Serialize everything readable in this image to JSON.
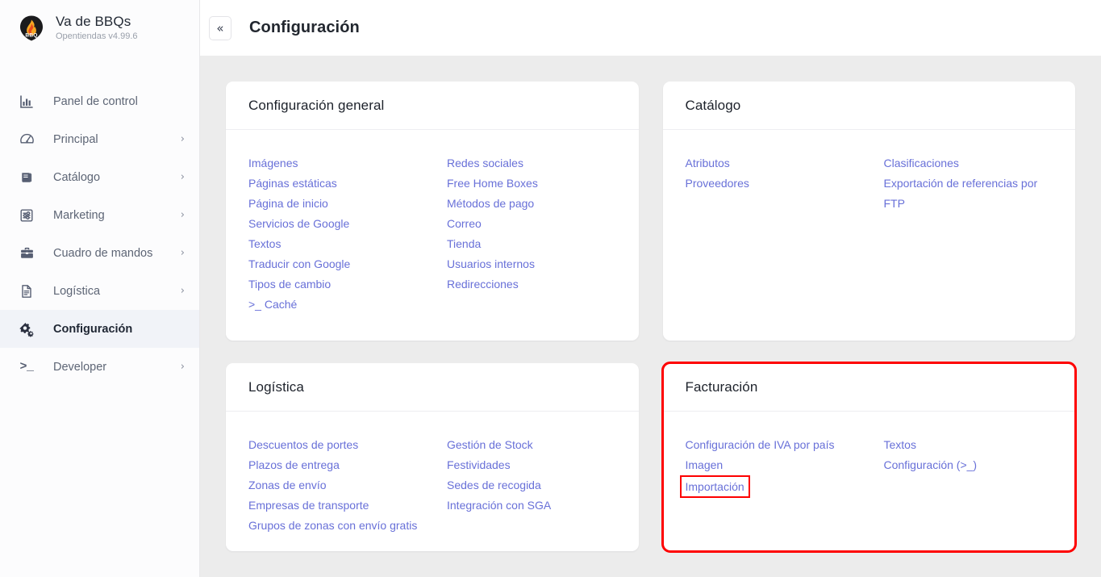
{
  "brand": {
    "title": "Va de BBQs",
    "subtitle": "Opentiendas v4.99.6",
    "logo_icon": "bbq-flame-badge-icon",
    "logo_label": "BBQ"
  },
  "topbar": {
    "collapse_icon": "double-chevron-left-icon",
    "collapse_glyph": "«",
    "page_title": "Configuración"
  },
  "sidebar": {
    "items": [
      {
        "label": "Panel de control",
        "icon": "bar-chart-icon",
        "name": "sidebar-item-panel-de-control",
        "expandable": false,
        "active": false
      },
      {
        "label": "Principal",
        "icon": "speedometer-icon",
        "name": "sidebar-item-principal",
        "expandable": true,
        "active": false
      },
      {
        "label": "Catálogo",
        "icon": "book-icon",
        "name": "sidebar-item-catalogo",
        "expandable": true,
        "active": false
      },
      {
        "label": "Marketing",
        "icon": "sliders-icon",
        "name": "sidebar-item-marketing",
        "expandable": true,
        "active": false
      },
      {
        "label": "Cuadro de mandos",
        "icon": "briefcase-icon",
        "name": "sidebar-item-cuadro-de-mandos",
        "expandable": true,
        "active": false
      },
      {
        "label": "Logística",
        "icon": "document-icon",
        "name": "sidebar-item-logistica",
        "expandable": true,
        "active": false
      },
      {
        "label": "Configuración",
        "icon": "gears-icon",
        "name": "sidebar-item-configuracion",
        "expandable": false,
        "active": true
      },
      {
        "label": "Developer",
        "icon": "terminal-icon",
        "name": "sidebar-item-developer",
        "expandable": true,
        "active": false
      }
    ],
    "chevron_glyph": "›"
  },
  "cards": [
    {
      "title": "Configuración general",
      "name": "card-configuracion-general",
      "highlighted": false,
      "columns": [
        {
          "links": [
            {
              "label": "Imágenes",
              "name": "link-imagenes"
            },
            {
              "label": "Páginas estáticas",
              "name": "link-paginas-estaticas"
            },
            {
              "label": "Página de inicio",
              "name": "link-pagina-de-inicio"
            },
            {
              "label": "Servicios de Google",
              "name": "link-servicios-de-google"
            },
            {
              "label": "Textos",
              "name": "link-textos"
            },
            {
              "label": "Traducir con Google",
              "name": "link-traducir-con-google"
            },
            {
              "label": "Tipos de cambio",
              "name": "link-tipos-de-cambio"
            },
            {
              "label": ">_ Caché",
              "name": "link-cache",
              "mono": true
            }
          ]
        },
        {
          "links": [
            {
              "label": "Redes sociales",
              "name": "link-redes-sociales"
            },
            {
              "label": "Free Home Boxes",
              "name": "link-free-home-boxes"
            },
            {
              "label": "Métodos de pago",
              "name": "link-metodos-de-pago"
            },
            {
              "label": "Correo",
              "name": "link-correo"
            },
            {
              "label": "Tienda",
              "name": "link-tienda"
            },
            {
              "label": "Usuarios internos",
              "name": "link-usuarios-internos"
            },
            {
              "label": "Redirecciones",
              "name": "link-redirecciones"
            }
          ]
        }
      ]
    },
    {
      "title": "Catálogo",
      "name": "card-catalogo",
      "highlighted": false,
      "columns": [
        {
          "links": [
            {
              "label": "Atributos",
              "name": "link-atributos"
            },
            {
              "label": "Proveedores",
              "name": "link-proveedores"
            }
          ]
        },
        {
          "links": [
            {
              "label": "Clasificaciones",
              "name": "link-clasificaciones"
            },
            {
              "label": "Exportación de referencias por FTP",
              "name": "link-exportacion-de-referencias-por-ftp"
            }
          ]
        }
      ]
    },
    {
      "title": "Logística",
      "name": "card-logistica",
      "highlighted": false,
      "columns": [
        {
          "links": [
            {
              "label": "Descuentos de portes",
              "name": "link-descuentos-de-portes"
            },
            {
              "label": "Plazos de entrega",
              "name": "link-plazos-de-entrega"
            },
            {
              "label": "Zonas de envío",
              "name": "link-zonas-de-envio"
            },
            {
              "label": "Empresas de transporte",
              "name": "link-empresas-de-transporte"
            },
            {
              "label": "Grupos de zonas con envío gratis",
              "name": "link-grupos-de-zonas-con-envio-gratis"
            }
          ]
        },
        {
          "links": [
            {
              "label": "Gestión de Stock",
              "name": "link-gestion-de-stock"
            },
            {
              "label": "Festividades",
              "name": "link-festividades"
            },
            {
              "label": "Sedes de recogida",
              "name": "link-sedes-de-recogida"
            },
            {
              "label": "Integración con SGA",
              "name": "link-integracion-con-sga"
            }
          ]
        }
      ]
    },
    {
      "title": "Facturación",
      "name": "card-facturacion",
      "highlighted": true,
      "columns": [
        {
          "links": [
            {
              "label": "Configuración de IVA por país",
              "name": "link-configuracion-de-iva-por-pais"
            },
            {
              "label": "Imagen",
              "name": "link-imagen"
            },
            {
              "label": "Importación",
              "name": "link-importacion",
              "boxed": true
            }
          ]
        },
        {
          "links": [
            {
              "label": "Textos",
              "name": "link-textos-facturacion"
            },
            {
              "label": "Configuración (>_)",
              "name": "link-configuracion-terminal",
              "mono": true
            }
          ]
        }
      ]
    }
  ],
  "colors": {
    "link": "#6870d8",
    "highlight_red": "#fe0000",
    "content_background": "#ececec",
    "sidebar_background": "#fcfcfd",
    "active_nav_background": "#f1f3f8"
  }
}
